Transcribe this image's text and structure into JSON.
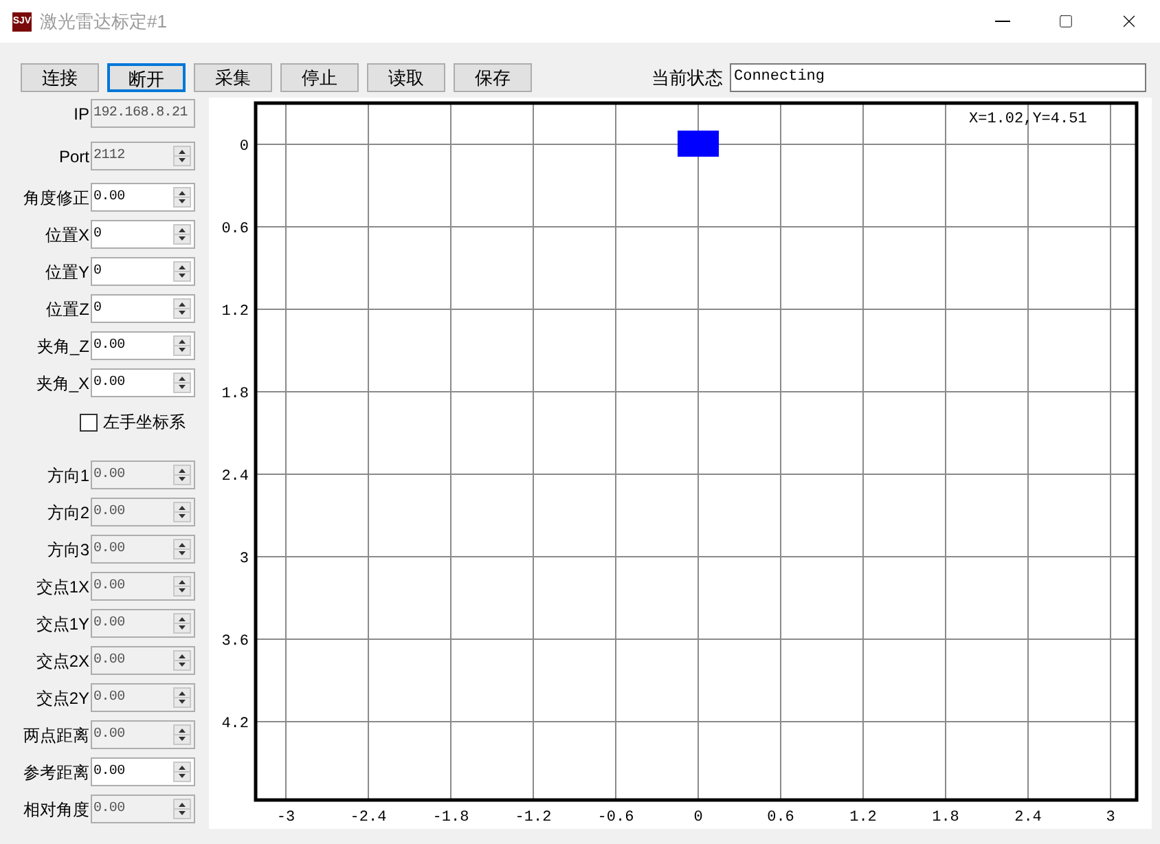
{
  "window": {
    "icon_text": "SJV",
    "title": "激光雷达标定#1"
  },
  "toolbar": [
    {
      "label": "连接",
      "focused": false
    },
    {
      "label": "断开",
      "focused": true
    },
    {
      "label": "采集",
      "focused": false
    },
    {
      "label": "停止",
      "focused": false
    },
    {
      "label": "读取",
      "focused": false
    },
    {
      "label": "保存",
      "focused": false
    }
  ],
  "status": {
    "label": "当前状态",
    "value": "Connecting"
  },
  "settings": [
    {
      "kind": "text",
      "label": "IP",
      "value": "192.168.8.21",
      "disabled": true
    },
    {
      "kind": "spin",
      "label": "Port",
      "value": "2112",
      "disabled": true
    },
    {
      "kind": "spin",
      "label": "角度修正",
      "value": "0.00",
      "disabled": false
    },
    {
      "kind": "spin",
      "label": "位置X",
      "value": "0",
      "disabled": false
    },
    {
      "kind": "spin",
      "label": "位置Y",
      "value": "0",
      "disabled": false
    },
    {
      "kind": "spin",
      "label": "位置Z",
      "value": "0",
      "disabled": false
    },
    {
      "kind": "spin",
      "label": "夹角_Z",
      "value": "0.00",
      "disabled": false
    },
    {
      "kind": "spin",
      "label": "夹角_X",
      "value": "0.00",
      "disabled": false
    },
    {
      "kind": "checkbox",
      "label": "左手坐标系",
      "checked": false
    }
  ],
  "results": [
    {
      "label": "方向1",
      "value": "0.00",
      "disabled": true
    },
    {
      "label": "方向2",
      "value": "0.00",
      "disabled": true
    },
    {
      "label": "方向3",
      "value": "0.00",
      "disabled": true
    },
    {
      "label": "交点1X",
      "value": "0.00",
      "disabled": true
    },
    {
      "label": "交点1Y",
      "value": "0.00",
      "disabled": true
    },
    {
      "label": "交点2X",
      "value": "0.00",
      "disabled": true
    },
    {
      "label": "交点2Y",
      "value": "0.00",
      "disabled": true
    },
    {
      "label": "两点距离",
      "value": "0.00",
      "disabled": true
    },
    {
      "label": "参考距离",
      "value": "0.00",
      "disabled": false
    },
    {
      "label": "相对角度",
      "value": "0.00",
      "disabled": true
    }
  ],
  "plot": {
    "readout": "X=1.02,Y=4.51",
    "chart_data": {
      "type": "scatter",
      "x": [
        0
      ],
      "grid": true,
      "series": [
        {
          "color": "#0000ff",
          "values": [
            0
          ]
        }
      ],
      "xlim": [
        -3.22,
        3.19
      ],
      "ylim": [
        4.77,
        -0.3
      ],
      "xticks": [
        -3,
        -2.4,
        -1.8,
        -1.2,
        -0.6,
        0,
        0.6,
        1.2,
        1.8,
        2.4,
        3
      ],
      "yticks": [
        0,
        0.6,
        1.2,
        1.8,
        2.4,
        3,
        3.6,
        4.2
      ]
    }
  }
}
